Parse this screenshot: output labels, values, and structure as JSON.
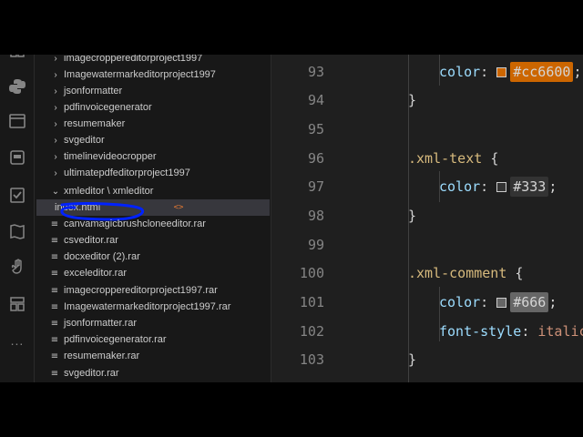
{
  "explorer": {
    "items": [
      {
        "label": "imagecroppereditorproject1997",
        "kind": "folder"
      },
      {
        "label": "Imagewatermarkeditorproject1997",
        "kind": "folder"
      },
      {
        "label": "jsonformatter",
        "kind": "folder"
      },
      {
        "label": "pdfinvoicegenerator",
        "kind": "folder"
      },
      {
        "label": "resumemaker",
        "kind": "folder"
      },
      {
        "label": "svgeditor",
        "kind": "folder"
      },
      {
        "label": "timelinevideocropper",
        "kind": "folder"
      },
      {
        "label": "ultimatepdfeditorproject1997",
        "kind": "folder"
      },
      {
        "label": "xmleditor \\ xmleditor",
        "kind": "folder-open"
      },
      {
        "label": "index.html",
        "kind": "html-file"
      },
      {
        "label": "canvamagicbrushcloneeditor.rar",
        "kind": "file"
      },
      {
        "label": "csveditor.rar",
        "kind": "file"
      },
      {
        "label": "docxeditor (2).rar",
        "kind": "file"
      },
      {
        "label": "exceleditor.rar",
        "kind": "file"
      },
      {
        "label": "imagecroppereditorproject1997.rar",
        "kind": "file"
      },
      {
        "label": "Imagewatermarkeditorproject1997.rar",
        "kind": "file"
      },
      {
        "label": "jsonformatter.rar",
        "kind": "file"
      },
      {
        "label": "pdfinvoicegenerator.rar",
        "kind": "file"
      },
      {
        "label": "resumemaker.rar",
        "kind": "file"
      },
      {
        "label": "svgeditor.rar",
        "kind": "file"
      }
    ]
  },
  "activity_bar": {
    "icons": [
      "extensions-icon",
      "python-icon",
      "browser-icon",
      "panel-icon",
      "checklist-icon",
      "map-icon",
      "hand-icon",
      "layout-icon",
      "more-icon"
    ],
    "more_label": "..."
  },
  "editor": {
    "lines": [
      {
        "num": "93",
        "indent": 2,
        "prop": "color",
        "colon": ":",
        "hex": "#cc6600",
        "end": ";"
      },
      {
        "num": "94",
        "indent": 1,
        "text": "}"
      },
      {
        "num": "95",
        "indent": 0,
        "text": ""
      },
      {
        "num": "96",
        "indent": 1,
        "selector": ".xml-text",
        "brace": "{"
      },
      {
        "num": "97",
        "indent": 2,
        "prop": "color",
        "colon": ":",
        "hex": "#333",
        "end": ";"
      },
      {
        "num": "98",
        "indent": 1,
        "text": "}"
      },
      {
        "num": "99",
        "indent": 0,
        "text": ""
      },
      {
        "num": "100",
        "indent": 1,
        "selector": ".xml-comment",
        "brace": "{"
      },
      {
        "num": "101",
        "indent": 2,
        "prop": "color",
        "colon": ":",
        "hex": "#666",
        "end": ";"
      },
      {
        "num": "102",
        "indent": 2,
        "prop": "font-style",
        "colon": ":",
        "value": "italic"
      },
      {
        "num": "103",
        "indent": 1,
        "text": "}"
      }
    ]
  },
  "colors": {
    "orange_swatch": "#cc6600",
    "dark_swatch": "#333333",
    "gray_swatch": "#666666",
    "annotation": "#0022ff"
  }
}
